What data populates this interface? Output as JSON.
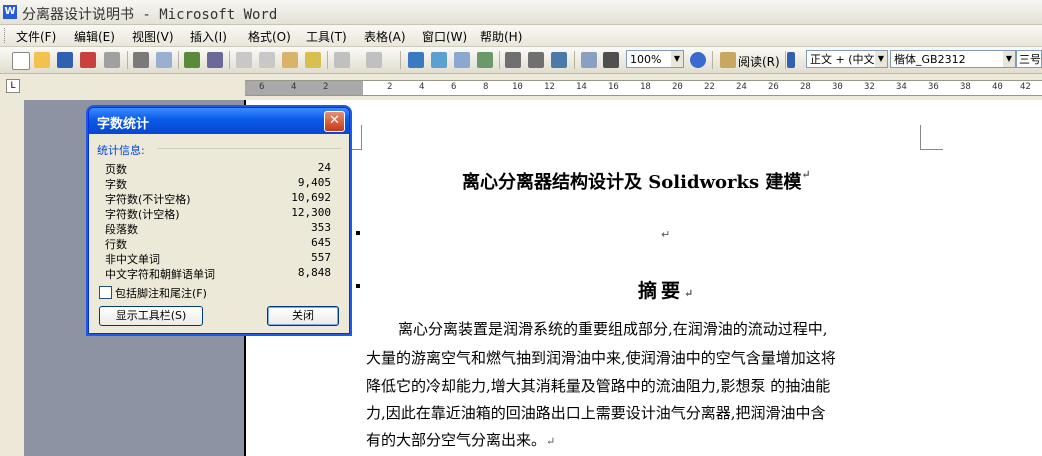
{
  "window": {
    "title": "分离器设计说明书 - Microsoft Word",
    "app_icon": "word-icon"
  },
  "menu": [
    "文件(F)",
    "编辑(E)",
    "视图(V)",
    "插入(I)",
    "格式(O)",
    "工具(T)",
    "表格(A)",
    "窗口(W)",
    "帮助(H)"
  ],
  "toolbar": {
    "zoom": "100%",
    "read_label": "阅读(R)",
    "style": "正文 + (中文",
    "font": "楷体_GB2312",
    "size": "三号"
  },
  "ruler": {
    "corner_symbol": "L",
    "ticks": [
      "6",
      "4",
      "2",
      "2",
      "4",
      "6",
      "8",
      "10",
      "12",
      "14",
      "16",
      "18",
      "20",
      "22",
      "24",
      "26",
      "28",
      "30",
      "32",
      "34",
      "36",
      "38",
      "40",
      "42"
    ]
  },
  "dialog": {
    "title": "字数统计",
    "group_label": "统计信息:",
    "stats": [
      {
        "label": "页数",
        "value": "24"
      },
      {
        "label": "字数",
        "value": "9,405"
      },
      {
        "label": "字符数(不计空格)",
        "value": "10,692"
      },
      {
        "label": "字符数(计空格)",
        "value": "12,300"
      },
      {
        "label": "段落数",
        "value": "353"
      },
      {
        "label": "行数",
        "value": "645"
      },
      {
        "label": "非中文单词",
        "value": "557"
      },
      {
        "label": "中文字符和朝鲜语单词",
        "value": "8,848"
      }
    ],
    "checkbox_label": "包括脚注和尾注(F)",
    "checkbox_checked": false,
    "toolbar_button": "显示工具栏(S)",
    "close_button": "关闭"
  },
  "document": {
    "title": "离心分离器结构设计及 Solidworks 建模",
    "paragraph_mark": "↵",
    "abstract_heading": "摘要",
    "body_lines": [
      "离心分离装置是润滑系统的重要组成部分,在润滑油的流动过程中,",
      "大量的游离空气和燃气抽到润滑油中来,使润滑油中的空气含量增加这将",
      "降低它的冷却能力,增大其消耗量及管路中的流油阻力,影想泵 的抽油能",
      "力,因此在靠近油箱的回油路出口上需要设计油气分离器,把润滑油中含",
      "有的大部分空气分离出来。"
    ]
  }
}
